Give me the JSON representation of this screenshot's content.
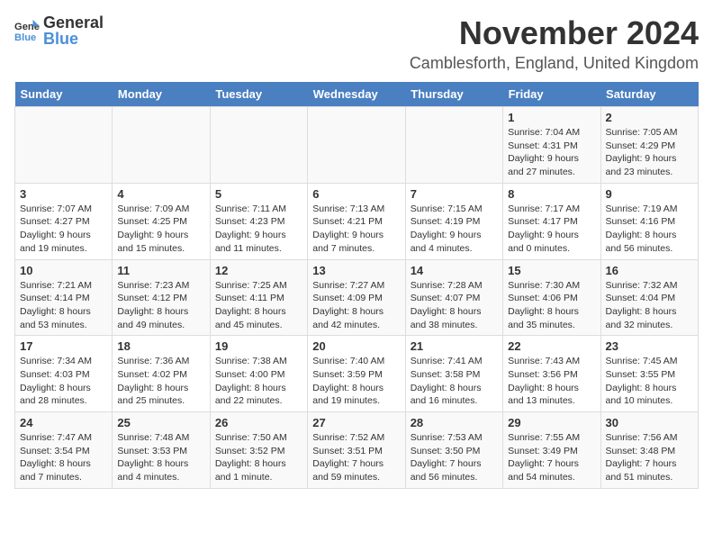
{
  "logo": {
    "text_general": "General",
    "text_blue": "Blue"
  },
  "header": {
    "month": "November 2024",
    "location": "Camblesforth, England, United Kingdom"
  },
  "days_of_week": [
    "Sunday",
    "Monday",
    "Tuesday",
    "Wednesday",
    "Thursday",
    "Friday",
    "Saturday"
  ],
  "weeks": [
    [
      {
        "day": null,
        "info": null
      },
      {
        "day": null,
        "info": null
      },
      {
        "day": null,
        "info": null
      },
      {
        "day": null,
        "info": null
      },
      {
        "day": null,
        "info": null
      },
      {
        "day": "1",
        "info": "Sunrise: 7:04 AM\nSunset: 4:31 PM\nDaylight: 9 hours and 27 minutes."
      },
      {
        "day": "2",
        "info": "Sunrise: 7:05 AM\nSunset: 4:29 PM\nDaylight: 9 hours and 23 minutes."
      }
    ],
    [
      {
        "day": "3",
        "info": "Sunrise: 7:07 AM\nSunset: 4:27 PM\nDaylight: 9 hours and 19 minutes."
      },
      {
        "day": "4",
        "info": "Sunrise: 7:09 AM\nSunset: 4:25 PM\nDaylight: 9 hours and 15 minutes."
      },
      {
        "day": "5",
        "info": "Sunrise: 7:11 AM\nSunset: 4:23 PM\nDaylight: 9 hours and 11 minutes."
      },
      {
        "day": "6",
        "info": "Sunrise: 7:13 AM\nSunset: 4:21 PM\nDaylight: 9 hours and 7 minutes."
      },
      {
        "day": "7",
        "info": "Sunrise: 7:15 AM\nSunset: 4:19 PM\nDaylight: 9 hours and 4 minutes."
      },
      {
        "day": "8",
        "info": "Sunrise: 7:17 AM\nSunset: 4:17 PM\nDaylight: 9 hours and 0 minutes."
      },
      {
        "day": "9",
        "info": "Sunrise: 7:19 AM\nSunset: 4:16 PM\nDaylight: 8 hours and 56 minutes."
      }
    ],
    [
      {
        "day": "10",
        "info": "Sunrise: 7:21 AM\nSunset: 4:14 PM\nDaylight: 8 hours and 53 minutes."
      },
      {
        "day": "11",
        "info": "Sunrise: 7:23 AM\nSunset: 4:12 PM\nDaylight: 8 hours and 49 minutes."
      },
      {
        "day": "12",
        "info": "Sunrise: 7:25 AM\nSunset: 4:11 PM\nDaylight: 8 hours and 45 minutes."
      },
      {
        "day": "13",
        "info": "Sunrise: 7:27 AM\nSunset: 4:09 PM\nDaylight: 8 hours and 42 minutes."
      },
      {
        "day": "14",
        "info": "Sunrise: 7:28 AM\nSunset: 4:07 PM\nDaylight: 8 hours and 38 minutes."
      },
      {
        "day": "15",
        "info": "Sunrise: 7:30 AM\nSunset: 4:06 PM\nDaylight: 8 hours and 35 minutes."
      },
      {
        "day": "16",
        "info": "Sunrise: 7:32 AM\nSunset: 4:04 PM\nDaylight: 8 hours and 32 minutes."
      }
    ],
    [
      {
        "day": "17",
        "info": "Sunrise: 7:34 AM\nSunset: 4:03 PM\nDaylight: 8 hours and 28 minutes."
      },
      {
        "day": "18",
        "info": "Sunrise: 7:36 AM\nSunset: 4:02 PM\nDaylight: 8 hours and 25 minutes."
      },
      {
        "day": "19",
        "info": "Sunrise: 7:38 AM\nSunset: 4:00 PM\nDaylight: 8 hours and 22 minutes."
      },
      {
        "day": "20",
        "info": "Sunrise: 7:40 AM\nSunset: 3:59 PM\nDaylight: 8 hours and 19 minutes."
      },
      {
        "day": "21",
        "info": "Sunrise: 7:41 AM\nSunset: 3:58 PM\nDaylight: 8 hours and 16 minutes."
      },
      {
        "day": "22",
        "info": "Sunrise: 7:43 AM\nSunset: 3:56 PM\nDaylight: 8 hours and 13 minutes."
      },
      {
        "day": "23",
        "info": "Sunrise: 7:45 AM\nSunset: 3:55 PM\nDaylight: 8 hours and 10 minutes."
      }
    ],
    [
      {
        "day": "24",
        "info": "Sunrise: 7:47 AM\nSunset: 3:54 PM\nDaylight: 8 hours and 7 minutes."
      },
      {
        "day": "25",
        "info": "Sunrise: 7:48 AM\nSunset: 3:53 PM\nDaylight: 8 hours and 4 minutes."
      },
      {
        "day": "26",
        "info": "Sunrise: 7:50 AM\nSunset: 3:52 PM\nDaylight: 8 hours and 1 minute."
      },
      {
        "day": "27",
        "info": "Sunrise: 7:52 AM\nSunset: 3:51 PM\nDaylight: 7 hours and 59 minutes."
      },
      {
        "day": "28",
        "info": "Sunrise: 7:53 AM\nSunset: 3:50 PM\nDaylight: 7 hours and 56 minutes."
      },
      {
        "day": "29",
        "info": "Sunrise: 7:55 AM\nSunset: 3:49 PM\nDaylight: 7 hours and 54 minutes."
      },
      {
        "day": "30",
        "info": "Sunrise: 7:56 AM\nSunset: 3:48 PM\nDaylight: 7 hours and 51 minutes."
      }
    ]
  ]
}
